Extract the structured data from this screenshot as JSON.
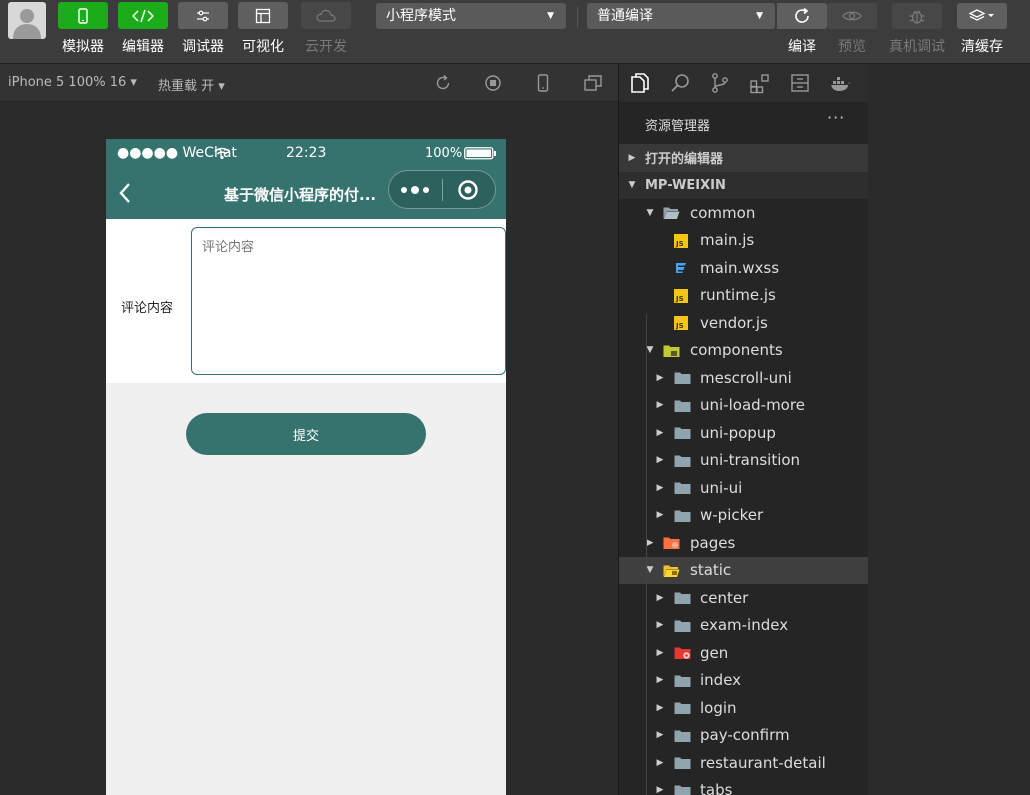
{
  "toolbar": {
    "buttons": [
      {
        "label": "模拟器",
        "icon": "phone-icon"
      },
      {
        "label": "编辑器",
        "icon": "code-icon"
      },
      {
        "label": "调试器",
        "icon": "sliders-icon"
      },
      {
        "label": "可视化",
        "icon": "layout-icon"
      },
      {
        "label": "云开发",
        "icon": "cloud-icon"
      }
    ],
    "mode_select": "小程序模式",
    "compile_select": "普通编译",
    "right_buttons": [
      {
        "label": "编译",
        "icon": "refresh-icon"
      },
      {
        "label": "预览",
        "icon": "eye-icon"
      },
      {
        "label": "真机调试",
        "icon": "bug-icon"
      },
      {
        "label": "清缓存",
        "icon": "layers-icon"
      }
    ]
  },
  "subbar": {
    "device": "iPhone 5 100% 16 ▾",
    "hot_reload": "热重载 开 ▾"
  },
  "phone": {
    "status": {
      "carrier": "●●●●● WeChat",
      "time": "22:23",
      "battery": "100%"
    },
    "nav_title": "基于微信小程序的付...",
    "form_label": "评论内容",
    "textarea_placeholder": "评论内容",
    "submit_label": "提交"
  },
  "explorer": {
    "title": "资源管理器",
    "more": "···",
    "open_editors": "打开的编辑器",
    "project": "MP-WEIXIN",
    "items": [
      {
        "name": "common",
        "depth": 1,
        "type": "folder-open",
        "arrow": "down"
      },
      {
        "name": "main.js",
        "depth": 2,
        "type": "js"
      },
      {
        "name": "main.wxss",
        "depth": 2,
        "type": "css"
      },
      {
        "name": "runtime.js",
        "depth": 2,
        "type": "js"
      },
      {
        "name": "vendor.js",
        "depth": 2,
        "type": "js"
      },
      {
        "name": "components",
        "depth": 1,
        "type": "folder-components",
        "arrow": "down"
      },
      {
        "name": "mescroll-uni",
        "depth": 2,
        "type": "folder",
        "arrow": "right"
      },
      {
        "name": "uni-load-more",
        "depth": 2,
        "type": "folder",
        "arrow": "right"
      },
      {
        "name": "uni-popup",
        "depth": 2,
        "type": "folder",
        "arrow": "right"
      },
      {
        "name": "uni-transition",
        "depth": 2,
        "type": "folder",
        "arrow": "right"
      },
      {
        "name": "uni-ui",
        "depth": 2,
        "type": "folder",
        "arrow": "right"
      },
      {
        "name": "w-picker",
        "depth": 2,
        "type": "folder",
        "arrow": "right"
      },
      {
        "name": "pages",
        "depth": 1,
        "type": "folder-pages",
        "arrow": "right"
      },
      {
        "name": "static",
        "depth": 1,
        "type": "folder-static",
        "arrow": "down",
        "selected": true
      },
      {
        "name": "center",
        "depth": 2,
        "type": "folder",
        "arrow": "right"
      },
      {
        "name": "exam-index",
        "depth": 2,
        "type": "folder",
        "arrow": "right"
      },
      {
        "name": "gen",
        "depth": 2,
        "type": "folder-gen",
        "arrow": "right"
      },
      {
        "name": "index",
        "depth": 2,
        "type": "folder",
        "arrow": "right"
      },
      {
        "name": "login",
        "depth": 2,
        "type": "folder",
        "arrow": "right"
      },
      {
        "name": "pay-confirm",
        "depth": 2,
        "type": "folder",
        "arrow": "right"
      },
      {
        "name": "restaurant-detail",
        "depth": 2,
        "type": "folder",
        "arrow": "right"
      },
      {
        "name": "tabs",
        "depth": 2,
        "type": "folder",
        "arrow": "right"
      }
    ]
  },
  "colors": {
    "accent_green": "#1aad19",
    "theme": "#36736f"
  }
}
